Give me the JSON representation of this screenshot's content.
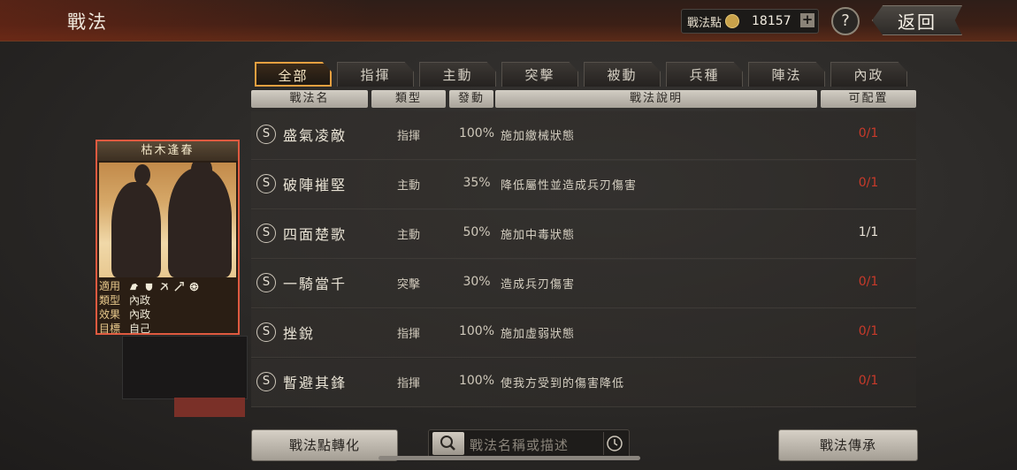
{
  "header": {
    "title": "戰法",
    "points_label": "戰法點",
    "points_value": "18157",
    "plus_label": "+",
    "help_label": "?",
    "back_label": "返回"
  },
  "tabs": [
    "全部",
    "指揮",
    "主動",
    "突擊",
    "被動",
    "兵種",
    "陣法",
    "內政"
  ],
  "active_tab": "全部",
  "columns": [
    "戰法名",
    "類型",
    "發動",
    "戰法說明",
    "可配置"
  ],
  "rows": [
    {
      "badge": "S",
      "name": "盛氣凌敵",
      "type": "指揮",
      "rate": "100%",
      "desc": "施加繳械狀態",
      "cap": "0/1",
      "cap_color": "#c83a2a"
    },
    {
      "badge": "S",
      "name": "破陣摧堅",
      "type": "主動",
      "rate": "35%",
      "desc": "降低屬性並造成兵刃傷害",
      "cap": "0/1",
      "cap_color": "#c83a2a"
    },
    {
      "badge": "S",
      "name": "四面楚歌",
      "type": "主動",
      "rate": "50%",
      "desc": "施加中毒狀態",
      "cap": "1/1",
      "cap_color": "#e8e2d6"
    },
    {
      "badge": "S",
      "name": "一騎當千",
      "type": "突擊",
      "rate": "30%",
      "desc": "造成兵刃傷害",
      "cap": "0/1",
      "cap_color": "#c83a2a"
    },
    {
      "badge": "S",
      "name": "挫銳",
      "type": "指揮",
      "rate": "100%",
      "desc": "施加虛弱狀態",
      "cap": "0/1",
      "cap_color": "#c83a2a"
    },
    {
      "badge": "S",
      "name": "暫避其鋒",
      "type": "指揮",
      "rate": "100%",
      "desc": "使我方受到的傷害降低",
      "cap": "0/1",
      "cap_color": "#c83a2a"
    }
  ],
  "card": {
    "name": "枯木逢春",
    "apply_key": "適用",
    "type_key": "類型",
    "type_val": "內政",
    "effect_key": "效果",
    "effect_val": "內政",
    "target_key": "目標",
    "target_val": "自己",
    "unit_icons": [
      "cavalry-icon",
      "shield-icon",
      "bow-icon",
      "spear-icon",
      "wheel-icon"
    ]
  },
  "footer": {
    "convert_label": "戰法點轉化",
    "search_placeholder": "戰法名稱或描述",
    "inherit_label": "戰法傳承"
  }
}
